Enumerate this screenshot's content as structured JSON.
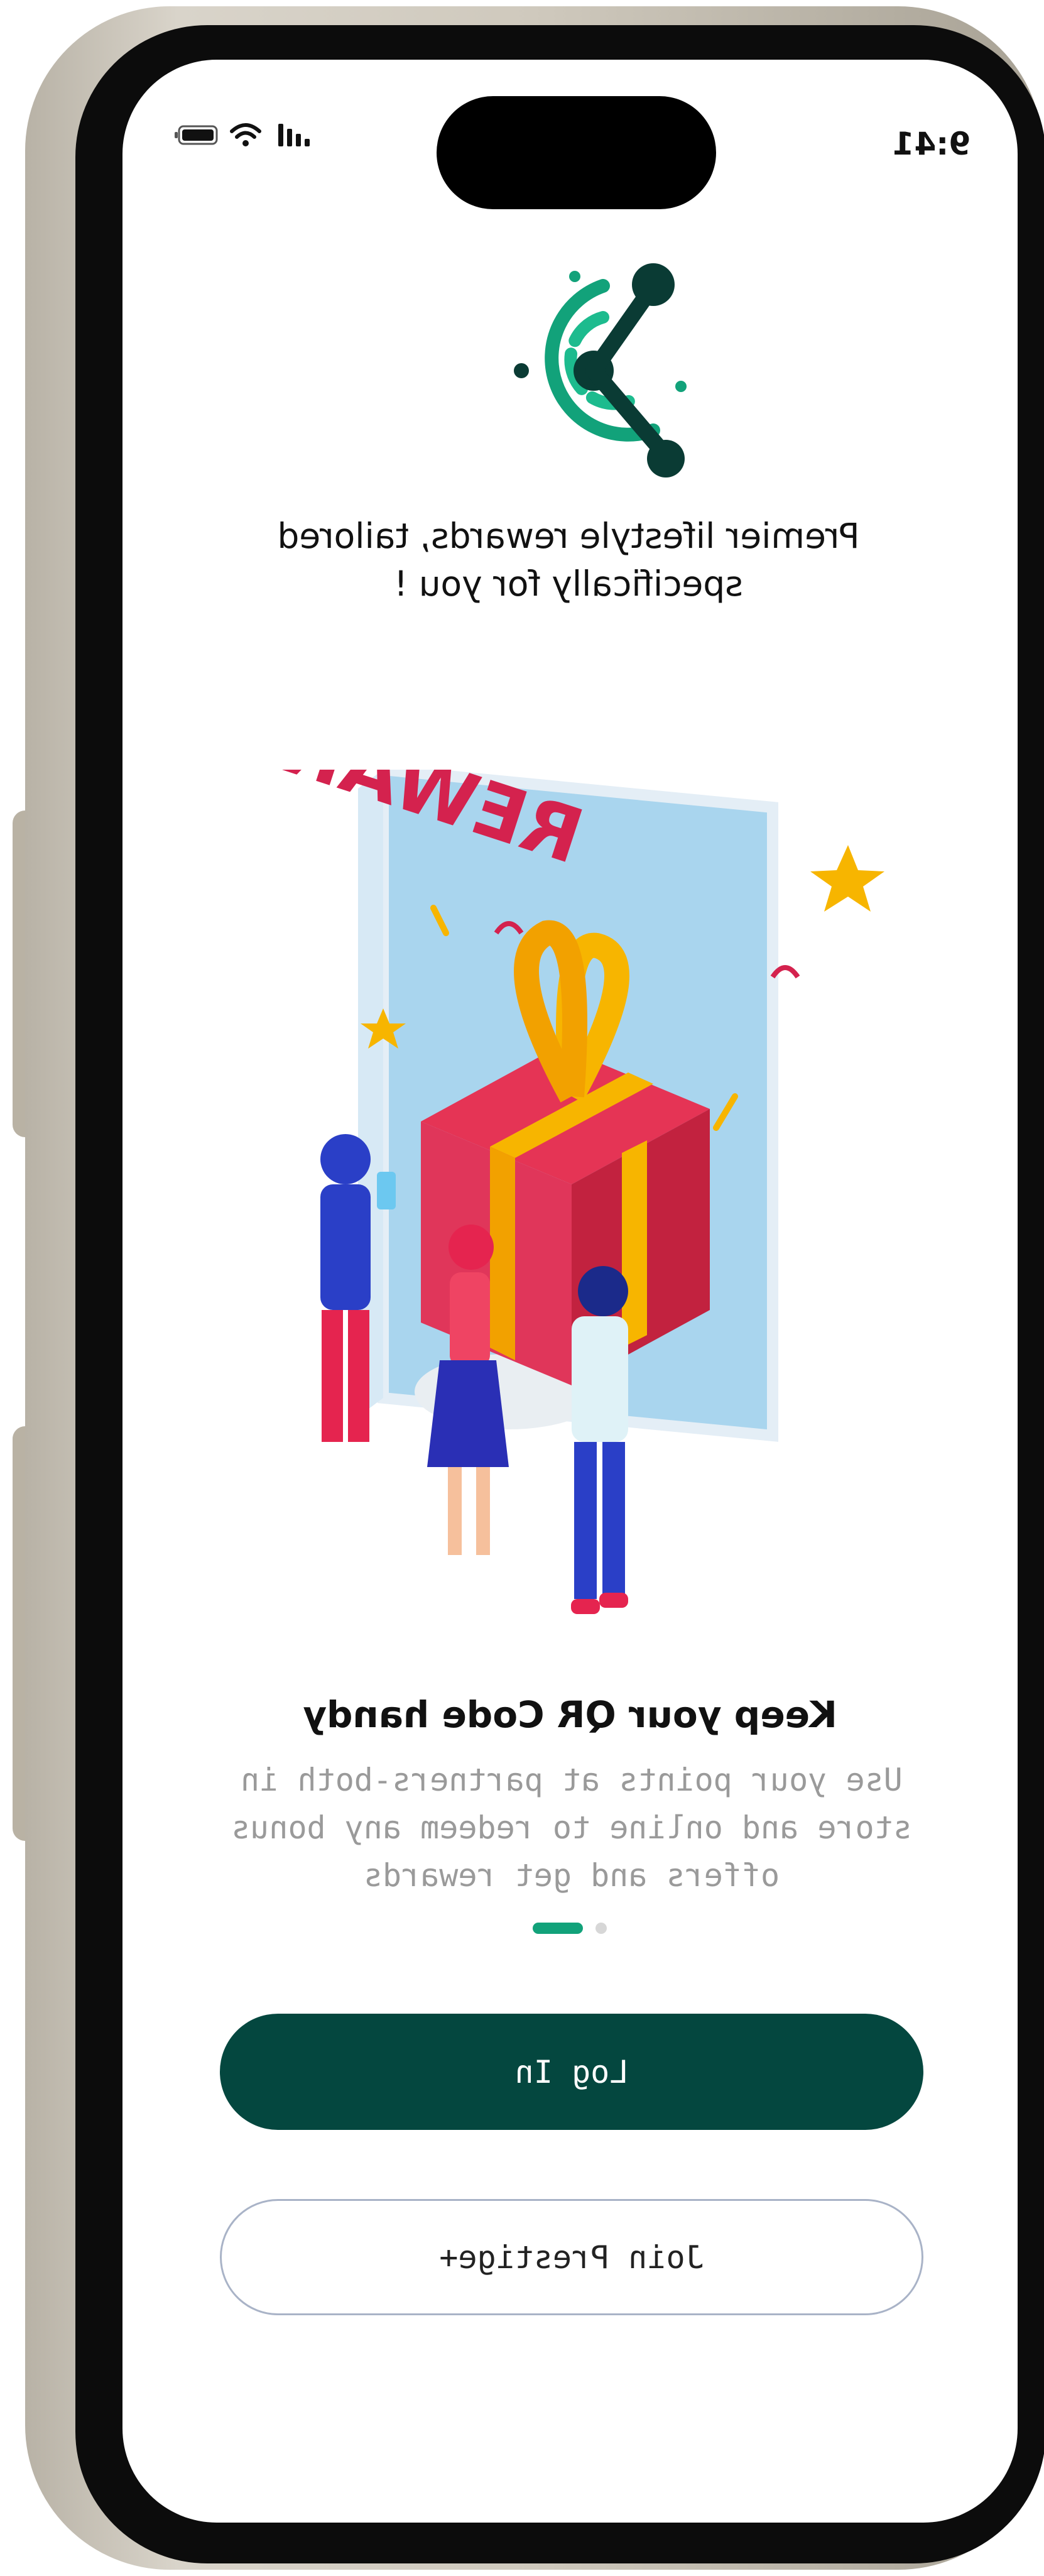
{
  "status_bar": {
    "time": "9:41"
  },
  "tagline": "Premier lifestyle rewards, tailored specifically for you !",
  "hero": {
    "badge_text": "REWARD"
  },
  "onboarding": {
    "title": "Keep your QR Code handy",
    "description": "Use your points at partners-both in store and online to redeem any bonus offers and get rewards",
    "page_indicator": {
      "current": 1,
      "total": 2
    }
  },
  "buttons": {
    "login": "Log In",
    "join": "Join Prestige+"
  },
  "colors": {
    "primary": "#04473f",
    "accent_green": "#12a27a",
    "logo_dark": "#0a3b34",
    "text_muted": "#9a9a9a"
  }
}
